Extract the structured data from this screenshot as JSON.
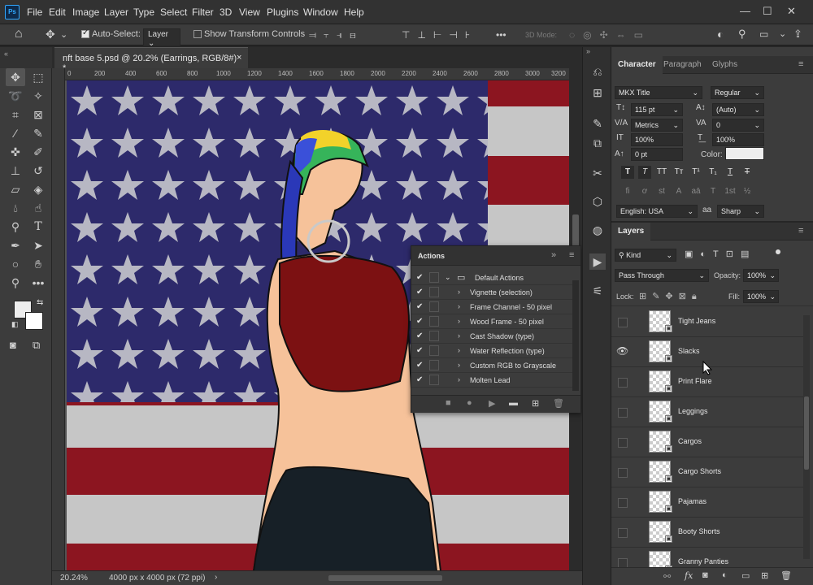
{
  "app": {
    "logo": "Ps",
    "menu": [
      "File",
      "Edit",
      "Image",
      "Layer",
      "Type",
      "Select",
      "Filter",
      "3D",
      "View",
      "Plugins",
      "Window",
      "Help"
    ],
    "window_controls": [
      "—",
      "☐",
      "✕"
    ]
  },
  "options": {
    "auto_select_label": "Auto-Select:",
    "auto_select_value": "Layer",
    "show_transform_label": "Show Transform Controls",
    "mode_3d": "3D Mode:",
    "more": "•••"
  },
  "document": {
    "tab_title": "nft base 5.psd @ 20.2% (Earrings, RGB/8#) *",
    "tab_close": "×",
    "ruler_ticks": [
      "0",
      "200",
      "400",
      "600",
      "800",
      "1000",
      "1200",
      "1400",
      "1600",
      "1800",
      "2000",
      "2200",
      "2400",
      "2600",
      "2800",
      "3000",
      "3200"
    ],
    "zoom": "20.24%",
    "doc_info": "4000 px x 4000 px (72 ppi)",
    "status_arrow": "›"
  },
  "actions_panel": {
    "title": "Actions",
    "set_name": "Default Actions",
    "items": [
      "Vignette (selection)",
      "Frame Channel - 50 pixel",
      "Wood Frame - 50 pixel",
      "Cast Shadow (type)",
      "Water Reflection (type)",
      "Custom RGB to Grayscale",
      "Molten Lead"
    ]
  },
  "character": {
    "tabs": [
      "Character",
      "Paragraph",
      "Glyphs"
    ],
    "font_family": "MKX Title",
    "font_style": "Regular",
    "font_size": "115 pt",
    "leading": "(Auto)",
    "kerning": "Metrics",
    "tracking": "0",
    "vscale": "100%",
    "hscale": "100%",
    "baseline": "0 pt",
    "color_label": "Color:",
    "color": "#eeeeee",
    "language": "English: USA",
    "aa_label": "aa",
    "antialias": "Sharp",
    "type_buttons": [
      "T",
      "T",
      "TT",
      "Tт",
      "T¹",
      "T₁",
      "T",
      "T"
    ],
    "ot_buttons": [
      "fi",
      "ơ",
      "st",
      "A",
      "aā",
      "T",
      "1st",
      "½"
    ]
  },
  "layers": {
    "title": "Layers",
    "filter_kind": "Kind",
    "blend_mode": "Pass Through",
    "opacity_label": "Opacity:",
    "opacity": "100%",
    "lock_label": "Lock:",
    "fill_label": "Fill:",
    "fill": "100%",
    "rows": [
      {
        "name": "Tight Jeans",
        "visible": false
      },
      {
        "name": "Slacks",
        "visible": true
      },
      {
        "name": "Print Flare",
        "visible": false
      },
      {
        "name": "Leggings",
        "visible": false
      },
      {
        "name": "Cargos",
        "visible": false
      },
      {
        "name": "Cargo Shorts",
        "visible": false
      },
      {
        "name": "Pajamas",
        "visible": false
      },
      {
        "name": "Booty Shorts",
        "visible": false
      },
      {
        "name": "Granny Panties",
        "visible": false
      }
    ],
    "bottom_icons": [
      "link-icon",
      "fx",
      "mask-icon",
      "adjustment-icon",
      "folder-icon",
      "new-layer-icon",
      "trash-icon"
    ]
  },
  "colors": {
    "accent": "#31a8ff",
    "flag_blue": "#2d2a6b",
    "flag_red": "#8c1520",
    "panel": "#3c3c3c",
    "shirt": "#7c1112"
  }
}
